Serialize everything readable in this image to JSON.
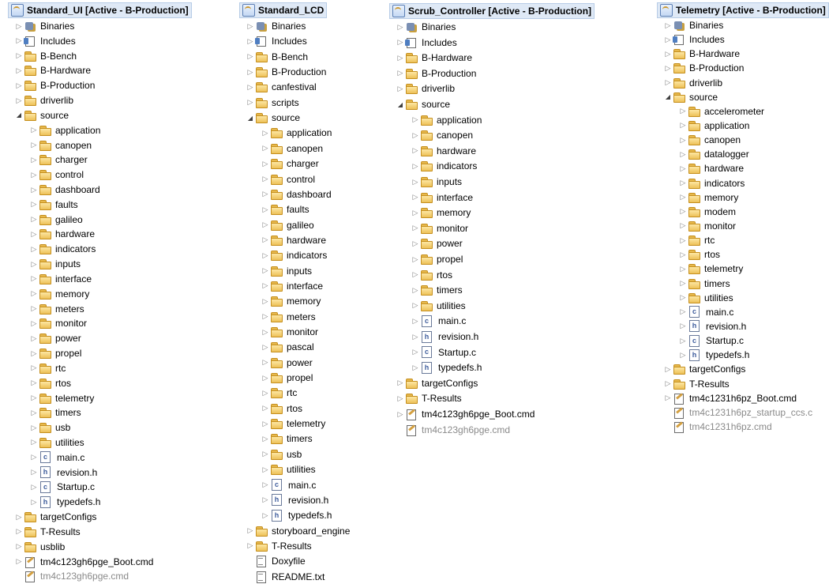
{
  "trees": [
    {
      "project": "Standard_UI  [Active - B-Production]",
      "items": [
        {
          "label": "Binaries",
          "type": "binaries",
          "arrow": "collapsed",
          "indent": 0
        },
        {
          "label": "Includes",
          "type": "includes",
          "arrow": "collapsed",
          "indent": 0
        },
        {
          "label": "B-Bench",
          "type": "folder",
          "arrow": "collapsed",
          "indent": 0
        },
        {
          "label": "B-Hardware",
          "type": "folder",
          "arrow": "collapsed",
          "indent": 0
        },
        {
          "label": "B-Production",
          "type": "folder",
          "arrow": "collapsed",
          "indent": 0
        },
        {
          "label": "driverlib",
          "type": "folder",
          "arrow": "collapsed",
          "indent": 0
        },
        {
          "label": "source",
          "type": "folder",
          "arrow": "expanded",
          "indent": 0
        },
        {
          "label": "application",
          "type": "folder",
          "arrow": "collapsed",
          "indent": 1
        },
        {
          "label": "canopen",
          "type": "folder",
          "arrow": "collapsed",
          "indent": 1
        },
        {
          "label": "charger",
          "type": "folder",
          "arrow": "collapsed",
          "indent": 1
        },
        {
          "label": "control",
          "type": "folder",
          "arrow": "collapsed",
          "indent": 1
        },
        {
          "label": "dashboard",
          "type": "folder",
          "arrow": "collapsed",
          "indent": 1
        },
        {
          "label": "faults",
          "type": "folder",
          "arrow": "collapsed",
          "indent": 1
        },
        {
          "label": "galileo",
          "type": "folder",
          "arrow": "collapsed",
          "indent": 1
        },
        {
          "label": "hardware",
          "type": "folder",
          "arrow": "collapsed",
          "indent": 1
        },
        {
          "label": "indicators",
          "type": "folder",
          "arrow": "collapsed",
          "indent": 1
        },
        {
          "label": "inputs",
          "type": "folder",
          "arrow": "collapsed",
          "indent": 1
        },
        {
          "label": "interface",
          "type": "folder",
          "arrow": "collapsed",
          "indent": 1
        },
        {
          "label": "memory",
          "type": "folder",
          "arrow": "collapsed",
          "indent": 1
        },
        {
          "label": "meters",
          "type": "folder",
          "arrow": "collapsed",
          "indent": 1
        },
        {
          "label": "monitor",
          "type": "folder",
          "arrow": "collapsed",
          "indent": 1
        },
        {
          "label": "power",
          "type": "folder",
          "arrow": "collapsed",
          "indent": 1
        },
        {
          "label": "propel",
          "type": "folder",
          "arrow": "collapsed",
          "indent": 1
        },
        {
          "label": "rtc",
          "type": "folder",
          "arrow": "collapsed",
          "indent": 1
        },
        {
          "label": "rtos",
          "type": "folder",
          "arrow": "collapsed",
          "indent": 1
        },
        {
          "label": "telemetry",
          "type": "folder",
          "arrow": "collapsed",
          "indent": 1
        },
        {
          "label": "timers",
          "type": "folder",
          "arrow": "collapsed",
          "indent": 1
        },
        {
          "label": "usb",
          "type": "folder",
          "arrow": "collapsed",
          "indent": 1
        },
        {
          "label": "utilities",
          "type": "folder",
          "arrow": "collapsed",
          "indent": 1
        },
        {
          "label": "main.c",
          "type": "cfile",
          "arrow": "collapsed",
          "indent": 1
        },
        {
          "label": "revision.h",
          "type": "hfile",
          "arrow": "collapsed",
          "indent": 1
        },
        {
          "label": "Startup.c",
          "type": "cfile",
          "arrow": "collapsed",
          "indent": 1
        },
        {
          "label": "typedefs.h",
          "type": "hfile",
          "arrow": "collapsed",
          "indent": 1
        },
        {
          "label": "targetConfigs",
          "type": "folder",
          "arrow": "collapsed",
          "indent": 0
        },
        {
          "label": "T-Results",
          "type": "folder",
          "arrow": "collapsed",
          "indent": 0
        },
        {
          "label": "usblib",
          "type": "folder",
          "arrow": "collapsed",
          "indent": 0
        },
        {
          "label": "tm4c123gh6pge_Boot.cmd",
          "type": "cmd",
          "arrow": "collapsed",
          "indent": 0
        },
        {
          "label": "tm4c123gh6pge.cmd",
          "type": "cmd",
          "arrow": "none",
          "indent": 0,
          "gray": true
        }
      ]
    },
    {
      "project": "Standard_LCD",
      "items": [
        {
          "label": "Binaries",
          "type": "binaries",
          "arrow": "collapsed",
          "indent": 0
        },
        {
          "label": "Includes",
          "type": "includes",
          "arrow": "collapsed",
          "indent": 0
        },
        {
          "label": "B-Bench",
          "type": "folder",
          "arrow": "collapsed",
          "indent": 0
        },
        {
          "label": "B-Production",
          "type": "folder",
          "arrow": "collapsed",
          "indent": 0
        },
        {
          "label": "canfestival",
          "type": "folder",
          "arrow": "collapsed",
          "indent": 0
        },
        {
          "label": "scripts",
          "type": "folder",
          "arrow": "collapsed",
          "indent": 0
        },
        {
          "label": "source",
          "type": "folder",
          "arrow": "expanded",
          "indent": 0
        },
        {
          "label": "application",
          "type": "folder",
          "arrow": "collapsed",
          "indent": 1
        },
        {
          "label": "canopen",
          "type": "folder",
          "arrow": "collapsed",
          "indent": 1
        },
        {
          "label": "charger",
          "type": "folder",
          "arrow": "collapsed",
          "indent": 1
        },
        {
          "label": "control",
          "type": "folder",
          "arrow": "collapsed",
          "indent": 1
        },
        {
          "label": "dashboard",
          "type": "folder",
          "arrow": "collapsed",
          "indent": 1
        },
        {
          "label": "faults",
          "type": "folder",
          "arrow": "collapsed",
          "indent": 1
        },
        {
          "label": "galileo",
          "type": "folder",
          "arrow": "collapsed",
          "indent": 1
        },
        {
          "label": "hardware",
          "type": "folder",
          "arrow": "collapsed",
          "indent": 1
        },
        {
          "label": "indicators",
          "type": "folder",
          "arrow": "collapsed",
          "indent": 1
        },
        {
          "label": "inputs",
          "type": "folder",
          "arrow": "collapsed",
          "indent": 1
        },
        {
          "label": "interface",
          "type": "folder",
          "arrow": "collapsed",
          "indent": 1
        },
        {
          "label": "memory",
          "type": "folder",
          "arrow": "collapsed",
          "indent": 1
        },
        {
          "label": "meters",
          "type": "folder",
          "arrow": "collapsed",
          "indent": 1
        },
        {
          "label": "monitor",
          "type": "folder",
          "arrow": "collapsed",
          "indent": 1
        },
        {
          "label": "pascal",
          "type": "folder",
          "arrow": "collapsed",
          "indent": 1
        },
        {
          "label": "power",
          "type": "folder",
          "arrow": "collapsed",
          "indent": 1
        },
        {
          "label": "propel",
          "type": "folder",
          "arrow": "collapsed",
          "indent": 1
        },
        {
          "label": "rtc",
          "type": "folder",
          "arrow": "collapsed",
          "indent": 1
        },
        {
          "label": "rtos",
          "type": "folder",
          "arrow": "collapsed",
          "indent": 1
        },
        {
          "label": "telemetry",
          "type": "folder",
          "arrow": "collapsed",
          "indent": 1
        },
        {
          "label": "timers",
          "type": "folder",
          "arrow": "collapsed",
          "indent": 1
        },
        {
          "label": "usb",
          "type": "folder",
          "arrow": "collapsed",
          "indent": 1
        },
        {
          "label": "utilities",
          "type": "folder",
          "arrow": "collapsed",
          "indent": 1
        },
        {
          "label": "main.c",
          "type": "cfile",
          "arrow": "collapsed",
          "indent": 1
        },
        {
          "label": "revision.h",
          "type": "hfile",
          "arrow": "collapsed",
          "indent": 1
        },
        {
          "label": "typedefs.h",
          "type": "hfile",
          "arrow": "collapsed",
          "indent": 1
        },
        {
          "label": "storyboard_engine",
          "type": "folder",
          "arrow": "collapsed",
          "indent": 0
        },
        {
          "label": "T-Results",
          "type": "folder",
          "arrow": "collapsed",
          "indent": 0
        },
        {
          "label": "Doxyfile",
          "type": "txtfile",
          "arrow": "none",
          "indent": 0
        },
        {
          "label": "README.txt",
          "type": "txtfile",
          "arrow": "none",
          "indent": 0
        }
      ]
    },
    {
      "project": "Scrub_Controller  [Active - B-Production]",
      "items": [
        {
          "label": "Binaries",
          "type": "binaries",
          "arrow": "collapsed",
          "indent": 0
        },
        {
          "label": "Includes",
          "type": "includes",
          "arrow": "collapsed",
          "indent": 0
        },
        {
          "label": "B-Hardware",
          "type": "folder",
          "arrow": "collapsed",
          "indent": 0
        },
        {
          "label": "B-Production",
          "type": "folder",
          "arrow": "collapsed",
          "indent": 0
        },
        {
          "label": "driverlib",
          "type": "folder",
          "arrow": "collapsed",
          "indent": 0
        },
        {
          "label": "source",
          "type": "folder",
          "arrow": "expanded",
          "indent": 0
        },
        {
          "label": "application",
          "type": "folder",
          "arrow": "collapsed",
          "indent": 1
        },
        {
          "label": "canopen",
          "type": "folder",
          "arrow": "collapsed",
          "indent": 1
        },
        {
          "label": "hardware",
          "type": "folder",
          "arrow": "collapsed",
          "indent": 1
        },
        {
          "label": "indicators",
          "type": "folder",
          "arrow": "collapsed",
          "indent": 1
        },
        {
          "label": "inputs",
          "type": "folder",
          "arrow": "collapsed",
          "indent": 1
        },
        {
          "label": "interface",
          "type": "folder",
          "arrow": "collapsed",
          "indent": 1
        },
        {
          "label": "memory",
          "type": "folder",
          "arrow": "collapsed",
          "indent": 1
        },
        {
          "label": "monitor",
          "type": "folder",
          "arrow": "collapsed",
          "indent": 1
        },
        {
          "label": "power",
          "type": "folder",
          "arrow": "collapsed",
          "indent": 1
        },
        {
          "label": "propel",
          "type": "folder",
          "arrow": "collapsed",
          "indent": 1
        },
        {
          "label": "rtos",
          "type": "folder",
          "arrow": "collapsed",
          "indent": 1
        },
        {
          "label": "timers",
          "type": "folder",
          "arrow": "collapsed",
          "indent": 1
        },
        {
          "label": "utilities",
          "type": "folder",
          "arrow": "collapsed",
          "indent": 1
        },
        {
          "label": "main.c",
          "type": "cfile",
          "arrow": "collapsed",
          "indent": 1
        },
        {
          "label": "revision.h",
          "type": "hfile",
          "arrow": "collapsed",
          "indent": 1
        },
        {
          "label": "Startup.c",
          "type": "cfile",
          "arrow": "collapsed",
          "indent": 1
        },
        {
          "label": "typedefs.h",
          "type": "hfile",
          "arrow": "collapsed",
          "indent": 1
        },
        {
          "label": "targetConfigs",
          "type": "folder",
          "arrow": "collapsed",
          "indent": 0
        },
        {
          "label": "T-Results",
          "type": "folder",
          "arrow": "collapsed",
          "indent": 0
        },
        {
          "label": "tm4c123gh6pge_Boot.cmd",
          "type": "cmd",
          "arrow": "collapsed",
          "indent": 0
        },
        {
          "label": "tm4c123gh6pge.cmd",
          "type": "cmd",
          "arrow": "none",
          "indent": 0,
          "gray": true
        }
      ]
    },
    {
      "project": "Telemetry  [Active - B-Production]",
      "items": [
        {
          "label": "Binaries",
          "type": "binaries",
          "arrow": "collapsed",
          "indent": 0
        },
        {
          "label": "Includes",
          "type": "includes",
          "arrow": "collapsed",
          "indent": 0
        },
        {
          "label": "B-Hardware",
          "type": "folder",
          "arrow": "collapsed",
          "indent": 0
        },
        {
          "label": "B-Production",
          "type": "folder",
          "arrow": "collapsed",
          "indent": 0
        },
        {
          "label": "driverlib",
          "type": "folder",
          "arrow": "collapsed",
          "indent": 0
        },
        {
          "label": "source",
          "type": "folder",
          "arrow": "expanded",
          "indent": 0
        },
        {
          "label": "accelerometer",
          "type": "folder",
          "arrow": "collapsed",
          "indent": 1
        },
        {
          "label": "application",
          "type": "folder",
          "arrow": "collapsed",
          "indent": 1
        },
        {
          "label": "canopen",
          "type": "folder",
          "arrow": "collapsed",
          "indent": 1
        },
        {
          "label": "datalogger",
          "type": "folder",
          "arrow": "collapsed",
          "indent": 1
        },
        {
          "label": "hardware",
          "type": "folder",
          "arrow": "collapsed",
          "indent": 1
        },
        {
          "label": "indicators",
          "type": "folder",
          "arrow": "collapsed",
          "indent": 1
        },
        {
          "label": "memory",
          "type": "folder",
          "arrow": "collapsed",
          "indent": 1
        },
        {
          "label": "modem",
          "type": "folder",
          "arrow": "collapsed",
          "indent": 1
        },
        {
          "label": "monitor",
          "type": "folder",
          "arrow": "collapsed",
          "indent": 1
        },
        {
          "label": "rtc",
          "type": "folder",
          "arrow": "collapsed",
          "indent": 1
        },
        {
          "label": "rtos",
          "type": "folder",
          "arrow": "collapsed",
          "indent": 1
        },
        {
          "label": "telemetry",
          "type": "folder",
          "arrow": "collapsed",
          "indent": 1
        },
        {
          "label": "timers",
          "type": "folder",
          "arrow": "collapsed",
          "indent": 1
        },
        {
          "label": "utilities",
          "type": "folder",
          "arrow": "collapsed",
          "indent": 1
        },
        {
          "label": "main.c",
          "type": "cfile",
          "arrow": "collapsed",
          "indent": 1
        },
        {
          "label": "revision.h",
          "type": "hfile",
          "arrow": "collapsed",
          "indent": 1
        },
        {
          "label": "Startup.c",
          "type": "cfile",
          "arrow": "collapsed",
          "indent": 1
        },
        {
          "label": "typedefs.h",
          "type": "hfile",
          "arrow": "collapsed",
          "indent": 1
        },
        {
          "label": "targetConfigs",
          "type": "folder",
          "arrow": "collapsed",
          "indent": 0
        },
        {
          "label": "T-Results",
          "type": "folder",
          "arrow": "collapsed",
          "indent": 0
        },
        {
          "label": "tm4c1231h6pz_Boot.cmd",
          "type": "cmd",
          "arrow": "collapsed",
          "indent": 0
        },
        {
          "label": "tm4c1231h6pz_startup_ccs.c",
          "type": "cmd",
          "arrow": "none",
          "indent": 0,
          "gray": true
        },
        {
          "label": "tm4c1231h6pz.cmd",
          "type": "cmd",
          "arrow": "none",
          "indent": 0,
          "gray": true
        }
      ]
    }
  ],
  "colors": {
    "text": "#000000",
    "gray_text": "#8a8a8a",
    "project_header_bg": "#dfe9f6",
    "arrow": "#808080"
  }
}
